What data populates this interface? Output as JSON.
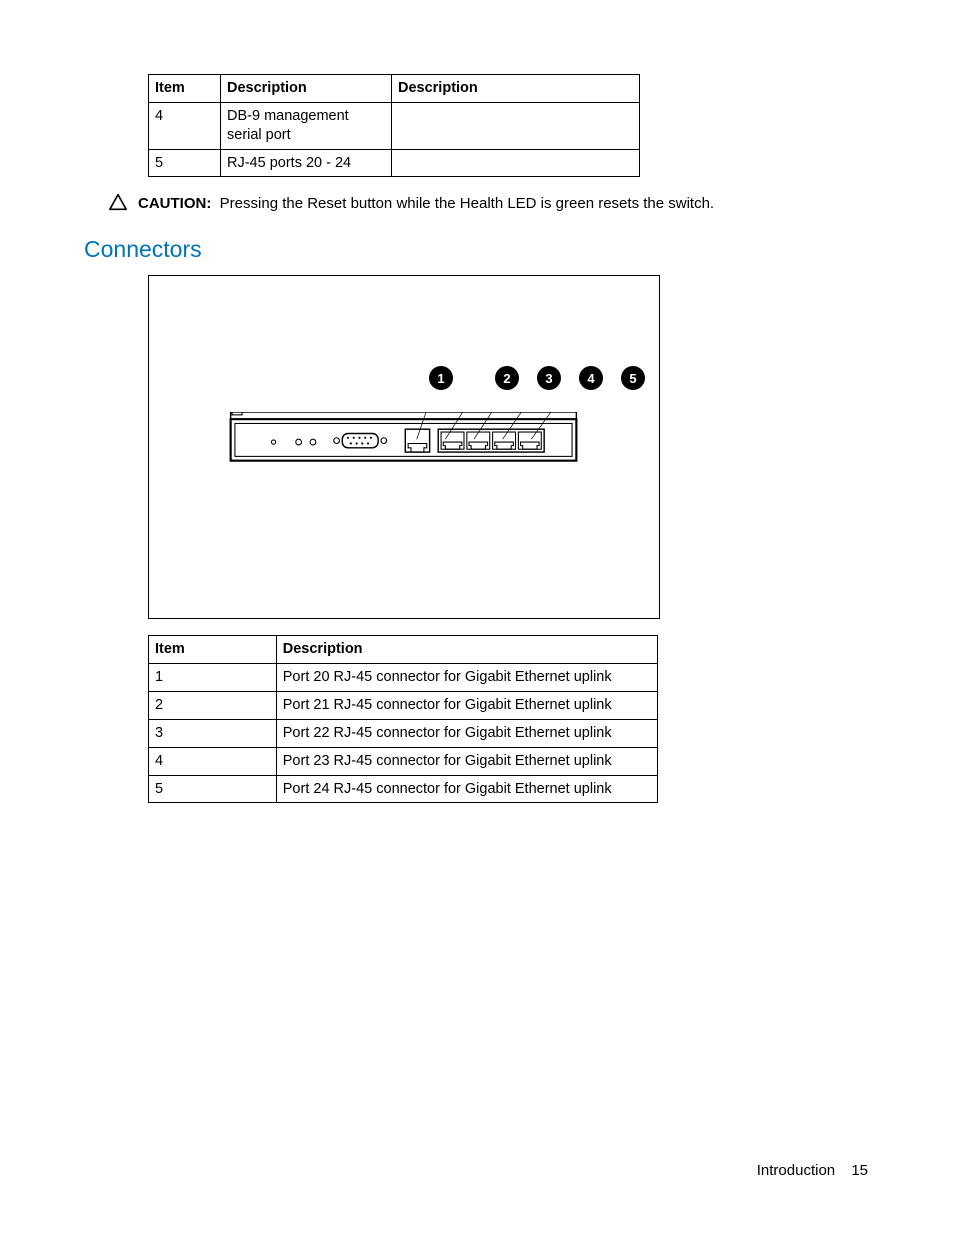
{
  "table_top": {
    "headers": [
      "Item",
      "Description",
      "Description"
    ],
    "rows": [
      {
        "item": "4",
        "desc1": "DB-9 management serial port",
        "desc2": ""
      },
      {
        "item": "5",
        "desc1": "RJ-45 ports 20 - 24",
        "desc2": ""
      }
    ]
  },
  "caution": {
    "label": "CAUTION:",
    "text": "Pressing the Reset button while the Health LED is green resets the switch."
  },
  "section_heading": "Connectors",
  "callouts": [
    "1",
    "2",
    "3",
    "4",
    "5"
  ],
  "table_bottom": {
    "headers": [
      "Item",
      "Description"
    ],
    "rows": [
      {
        "item": "1",
        "desc": "Port 20 RJ-45 connector for Gigabit Ethernet uplink"
      },
      {
        "item": "2",
        "desc": "Port 21 RJ-45 connector for Gigabit Ethernet uplink"
      },
      {
        "item": "3",
        "desc": "Port 22 RJ-45 connector for Gigabit Ethernet uplink"
      },
      {
        "item": "4",
        "desc": "Port 23 RJ-45 connector for Gigabit Ethernet uplink"
      },
      {
        "item": "5",
        "desc": "Port 24 RJ-45 connector for Gigabit Ethernet uplink"
      }
    ]
  },
  "footer": {
    "section": "Introduction",
    "page": "15"
  }
}
